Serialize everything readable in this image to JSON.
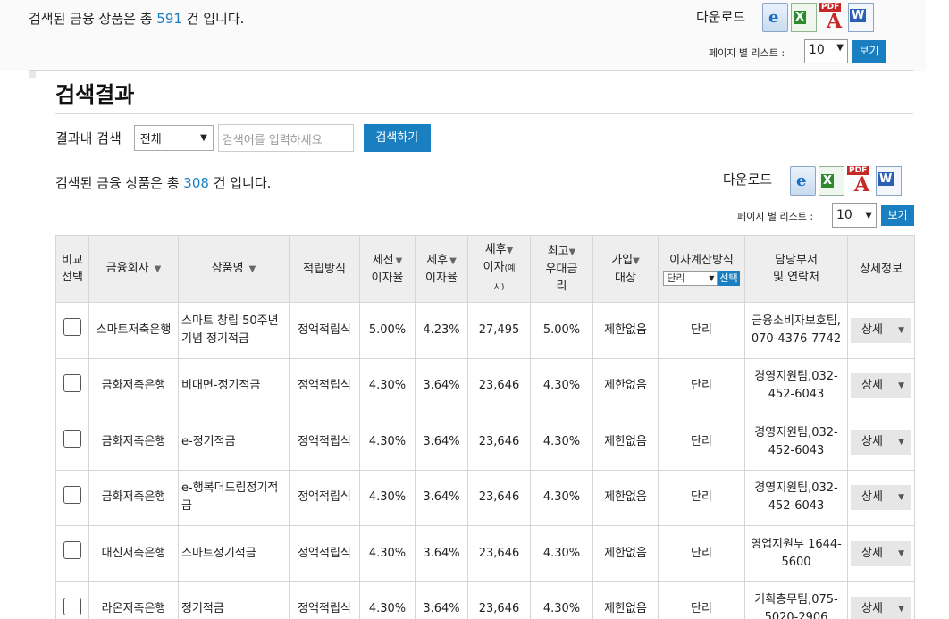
{
  "background": {
    "count_prefix": "검색된 금융 상품은 총 ",
    "count": "591",
    "count_suffix": " 건 입니다.",
    "download_label": "다운로드",
    "per_page_label": "페이지 별 리스트 :",
    "per_page_value": "10",
    "view_button": "보기"
  },
  "main": {
    "title": "검색결과",
    "search_label": "결과내 검색",
    "search_scope": "전체",
    "search_placeholder": "검색어를 입력하세요",
    "search_button": "검색하기",
    "count_prefix": "검색된 금융 상품은 총 ",
    "count": "308",
    "count_suffix": " 건 입니다.",
    "download_label": "다운로드",
    "per_page_label": "페이지 별 리스트 :",
    "per_page_value": "10",
    "view_button": "보기"
  },
  "icons": [
    "ie-icon",
    "excel-icon",
    "pdf-icon",
    "word-icon"
  ],
  "table": {
    "headers": {
      "compare_1": "비교",
      "compare_2": "선택",
      "company": "금융회사",
      "product": "상품명",
      "method": "적립방식",
      "pretax_1": "세전",
      "pretax_2": "이자율",
      "aftertax_1": "세후",
      "aftertax_2": "이자율",
      "interest_1": "세후",
      "interest_2": "이자",
      "interest_3": "(예",
      "interest_4": "시)",
      "best_1": "최고",
      "best_2": "우대금",
      "best_3": "리",
      "target_1": "가입",
      "target_2": "대상",
      "calc": "이자계산방식",
      "calc_select": "단리",
      "calc_button": "선택",
      "contact_1": "담당부서",
      "contact_2": "및 연락처",
      "detail": "상세정보"
    },
    "rows": [
      {
        "company": "스마트저축은행",
        "product": "스마트 창립 50주년 기념 정기적금",
        "method": "정액적립식",
        "pretax": "5.00%",
        "aftertax": "4.23%",
        "interest": "27,495",
        "best": "5.00%",
        "target": "제한없음",
        "calc": "단리",
        "contact": "금융소비자보호팀, 070-4376-7742",
        "detail": "상세"
      },
      {
        "company": "금화저축은행",
        "product": "비대면-정기적금",
        "method": "정액적립식",
        "pretax": "4.30%",
        "aftertax": "3.64%",
        "interest": "23,646",
        "best": "4.30%",
        "target": "제한없음",
        "calc": "단리",
        "contact": "경영지원팀,032-452-6043",
        "detail": "상세"
      },
      {
        "company": "금화저축은행",
        "product": "e-정기적금",
        "method": "정액적립식",
        "pretax": "4.30%",
        "aftertax": "3.64%",
        "interest": "23,646",
        "best": "4.30%",
        "target": "제한없음",
        "calc": "단리",
        "contact": "경영지원팀,032-452-6043",
        "detail": "상세"
      },
      {
        "company": "금화저축은행",
        "product": "e-행복더드림정기적금",
        "method": "정액적립식",
        "pretax": "4.30%",
        "aftertax": "3.64%",
        "interest": "23,646",
        "best": "4.30%",
        "target": "제한없음",
        "calc": "단리",
        "contact": "경영지원팀,032-452-6043",
        "detail": "상세"
      },
      {
        "company": "대신저축은행",
        "product": "스마트정기적금",
        "method": "정액적립식",
        "pretax": "4.30%",
        "aftertax": "3.64%",
        "interest": "23,646",
        "best": "4.30%",
        "target": "제한없음",
        "calc": "단리",
        "contact": "영업지원부 1644-5600",
        "detail": "상세"
      },
      {
        "company": "라온저축은행",
        "product": "정기적금",
        "method": "정액적립식",
        "pretax": "4.30%",
        "aftertax": "3.64%",
        "interest": "23,646",
        "best": "4.30%",
        "target": "제한없음",
        "calc": "단리",
        "contact": "기획총무팀,075-5020-2906",
        "detail": "상세"
      }
    ]
  }
}
